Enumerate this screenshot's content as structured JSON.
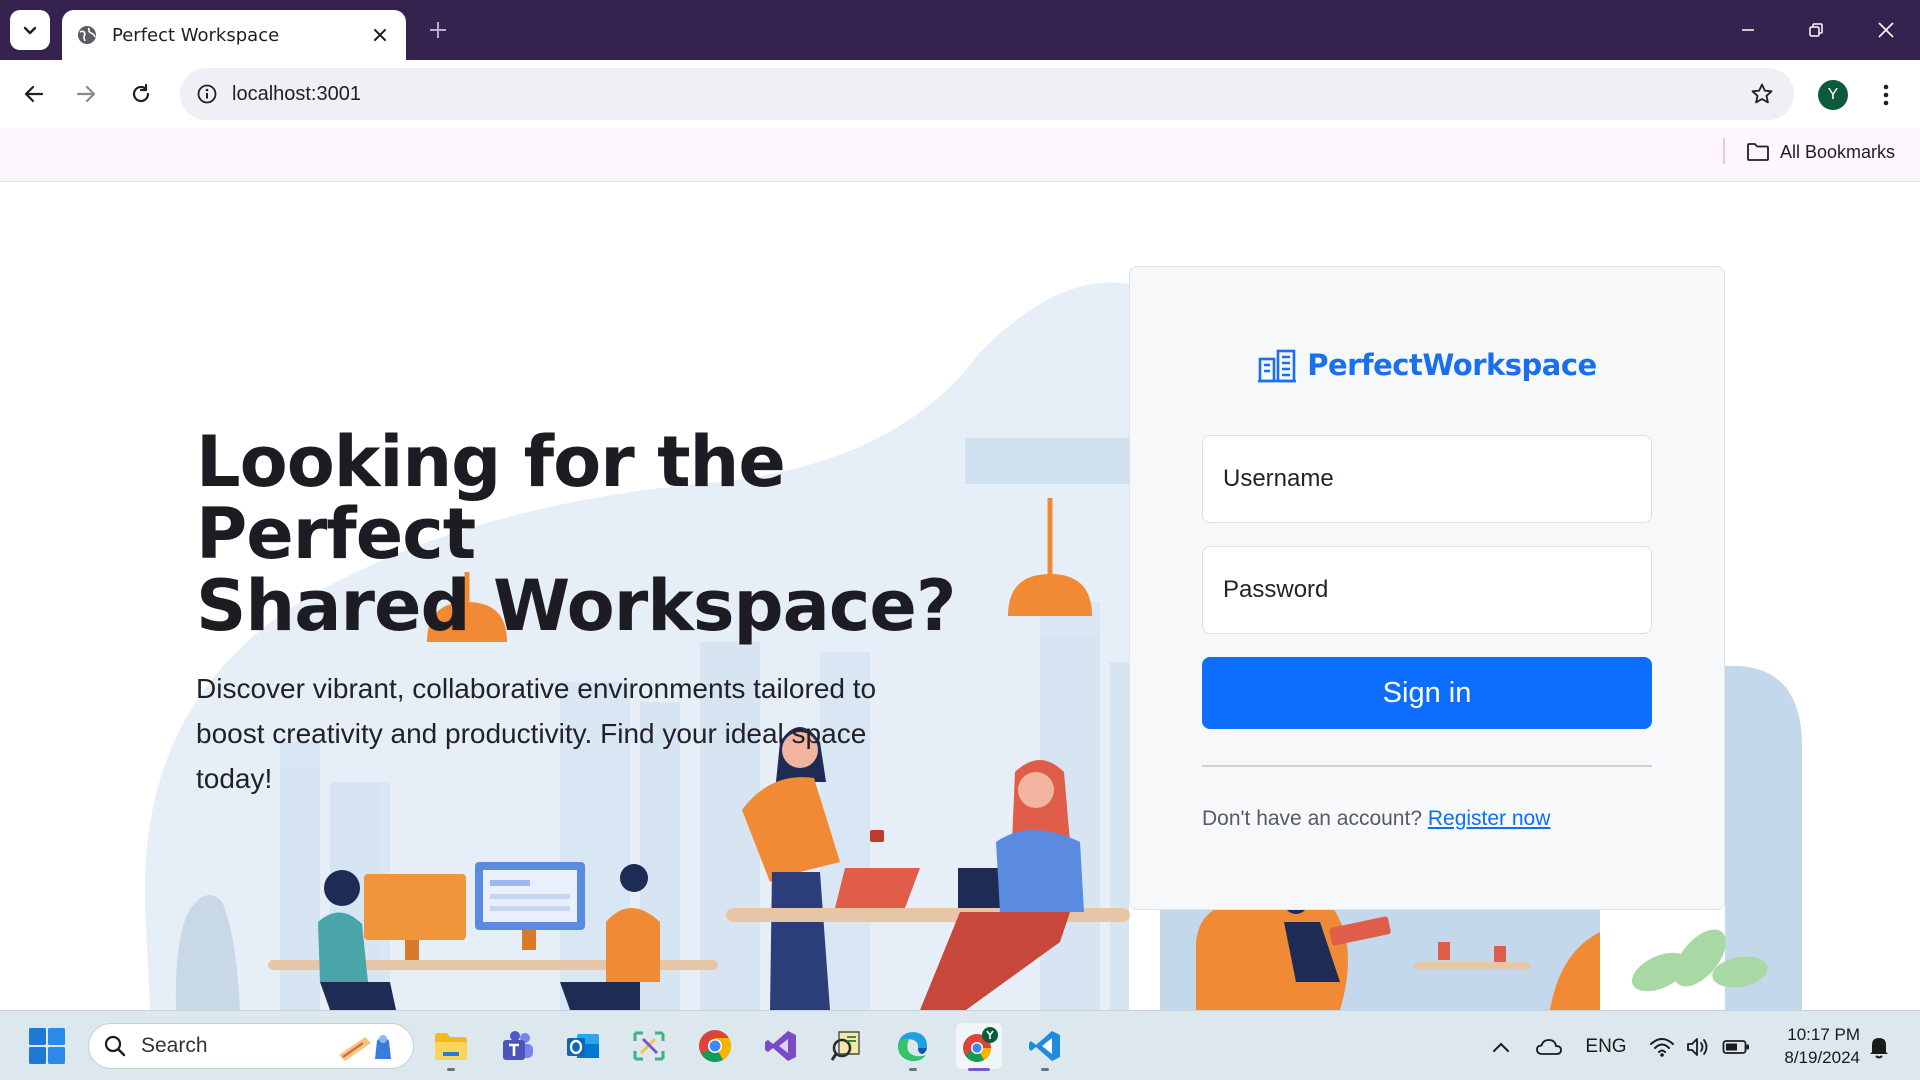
{
  "browser": {
    "tab_title": "Perfect Workspace",
    "url": "localhost:3001",
    "profile_initial": "Y",
    "bookmarks_label": "All Bookmarks"
  },
  "hero": {
    "title_line1": "Looking for the Perfect",
    "title_line2": "Shared Workspace?",
    "subtitle": "Discover vibrant, collaborative environments tailored to boost creativity and productivity. Find your ideal space today!"
  },
  "login": {
    "brand": "PerfectWorkspace",
    "username_placeholder": "Username",
    "password_placeholder": "Password",
    "signin_label": "Sign in",
    "register_prompt": "Don't have an account?",
    "register_link": "Register now"
  },
  "taskbar": {
    "search_label": "Search",
    "language": "ENG",
    "time": "10:17 PM",
    "date": "8/19/2024",
    "apps": [
      "file-explorer-icon",
      "teams-icon",
      "outlook-icon",
      "snipping-tool-icon",
      "chrome-icon",
      "visual-studio-icon",
      "pdf-reader-icon",
      "edge-icon",
      "chrome-profile-icon",
      "vscode-icon"
    ]
  },
  "colors": {
    "titlebar": "#35224f",
    "brand": "#1a6ff0",
    "primary_button": "#0d6efd",
    "taskbar": "#dde7ee"
  }
}
